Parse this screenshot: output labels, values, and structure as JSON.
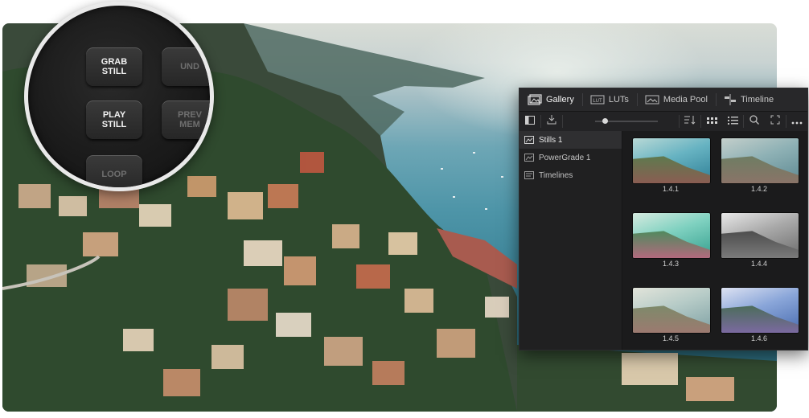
{
  "magnifier": {
    "keys": [
      {
        "line1": "GRAB",
        "line2": "STILL"
      },
      {
        "line1": "UND",
        "line2": ""
      },
      {
        "line1": "PLAY",
        "line2": "STILL"
      },
      {
        "line1": "PREV",
        "line2": "MEM"
      },
      {
        "line1": "LOOP",
        "line2": ""
      }
    ]
  },
  "gallery": {
    "tabs": [
      {
        "label": "Gallery",
        "icon": "gallery-icon",
        "active": true
      },
      {
        "label": "LUTs",
        "icon": "luts-icon",
        "active": false
      },
      {
        "label": "Media Pool",
        "icon": "media-pool-icon",
        "active": false
      },
      {
        "label": "Timeline",
        "icon": "timeline-icon",
        "active": false
      }
    ],
    "toolbar": {
      "icons": [
        "sidebar-toggle-icon",
        "import-icon",
        "thumbnail-size-slider",
        "sort-icon",
        "grid-view-icon",
        "list-view-icon",
        "search-icon",
        "expand-icon",
        "more-options-icon"
      ],
      "zoom_level": 0.15
    },
    "albums": [
      {
        "label": "Stills 1",
        "selected": true
      },
      {
        "label": "PowerGrade 1",
        "selected": false
      },
      {
        "label": "Timelines",
        "selected": false
      }
    ],
    "stills": [
      {
        "label": "1.4.1",
        "tone": "natural"
      },
      {
        "label": "1.4.2",
        "tone": "faded"
      },
      {
        "label": "1.4.3",
        "tone": "teal"
      },
      {
        "label": "1.4.4",
        "tone": "mono"
      },
      {
        "label": "1.4.5",
        "tone": "warm-faded"
      },
      {
        "label": "1.4.6",
        "tone": "cool"
      }
    ]
  }
}
